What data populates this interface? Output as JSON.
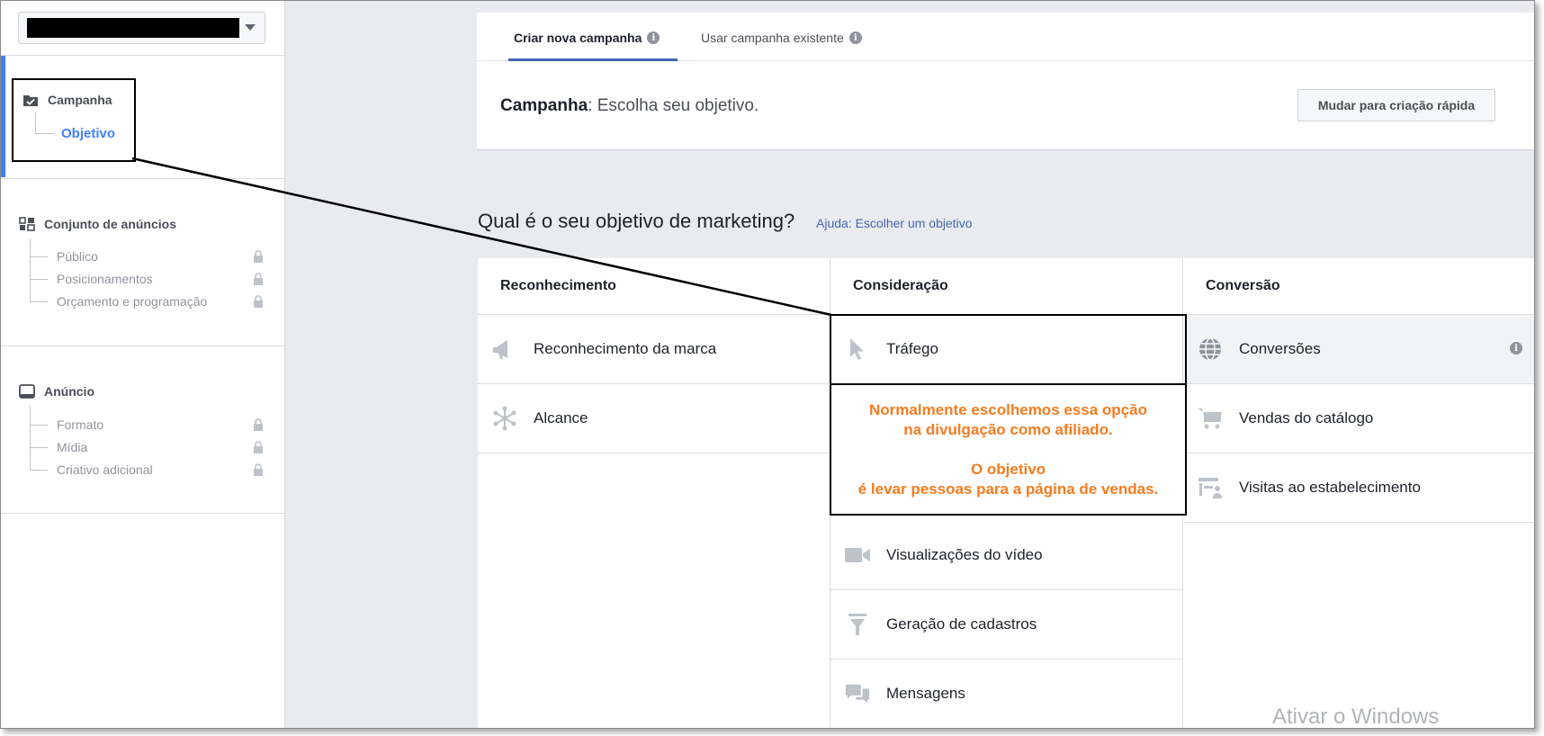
{
  "sidebar": {
    "account_select_redacted": true,
    "campaign": {
      "title": "Campanha",
      "objective": "Objetivo"
    },
    "adset": {
      "title": "Conjunto de anúncios",
      "items": [
        "Público",
        "Posicionamentos",
        "Orçamento e programação"
      ]
    },
    "ad": {
      "title": "Anúncio",
      "items": [
        "Formato",
        "Mídia",
        "Criativo adicional"
      ]
    }
  },
  "tabs": {
    "new_campaign": "Criar nova campanha",
    "existing_campaign": "Usar campanha existente"
  },
  "campaign_header": {
    "label": "Campanha",
    "text": ": Escolha seu objetivo.",
    "quick_button": "Mudar para criação rápida"
  },
  "objective_section": {
    "question": "Qual é o seu objetivo de marketing?",
    "help_link": "Ajuda: Escolher um objetivo",
    "columns": [
      {
        "title": "Reconhecimento",
        "items": [
          "Reconhecimento da marca",
          "Alcance"
        ]
      },
      {
        "title": "Consideração",
        "items": [
          "Tráfego",
          "Visualizações do vídeo",
          "Geração de cadastros",
          "Mensagens"
        ]
      },
      {
        "title": "Conversão",
        "items": [
          "Conversões",
          "Vendas do catálogo",
          "Visitas ao estabelecimento"
        ]
      }
    ]
  },
  "annotation": {
    "line1": "Normalmente escolhemos essa opção",
    "line2": "na divulgação como afiliado.",
    "line3": "O objetivo",
    "line4": "é levar pessoas para a página de vendas."
  },
  "watermark": "Ativar o Windows",
  "colors": {
    "accent": "#4080ff",
    "annotation_text": "#f57c20",
    "link": "#4267b2"
  }
}
